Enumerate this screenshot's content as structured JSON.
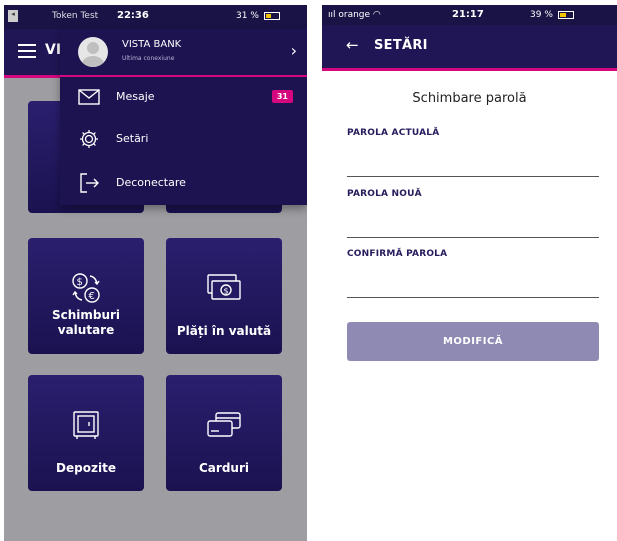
{
  "left_screen": {
    "status_bar": {
      "carrier": "Token Test",
      "time": "22:36",
      "battery": "31 %"
    },
    "app_bar": {
      "title": "VI"
    },
    "tiles": [
      {
        "label": "Schimburi valutare",
        "icon": "currency-exchange-icon"
      },
      {
        "label": "Plăți în valută",
        "icon": "banknotes-icon"
      },
      {
        "label": "Depozite",
        "icon": "safe-icon"
      },
      {
        "label": "Carduri",
        "icon": "cards-icon"
      }
    ],
    "menu": {
      "bank_name": "VISTA BANK",
      "last_connection": "Ultima conexiune",
      "items": [
        {
          "label": "Mesaje",
          "icon": "envelope-icon",
          "badge": "31"
        },
        {
          "label": "Setări",
          "icon": "gear-icon"
        },
        {
          "label": "Deconectare",
          "icon": "logout-icon"
        }
      ]
    },
    "colors": {
      "primary": "#201656",
      "accent": "#d4077f",
      "overlay": "#9e9ea2"
    }
  },
  "right_screen": {
    "status_bar": {
      "carrier": "orange",
      "time": "21:17",
      "battery": "39 %"
    },
    "app_bar": {
      "title": "SETĂRI"
    },
    "form": {
      "title": "Schimbare parolă",
      "current_label": "PAROLA ACTUALĂ",
      "current_value": "",
      "new_label": "PAROLA NOUĂ",
      "new_value": "",
      "confirm_label": "CONFIRMĂ PAROLA",
      "confirm_value": "",
      "submit": "MODIFICĂ"
    },
    "colors": {
      "button": "#8f8ab3"
    }
  }
}
